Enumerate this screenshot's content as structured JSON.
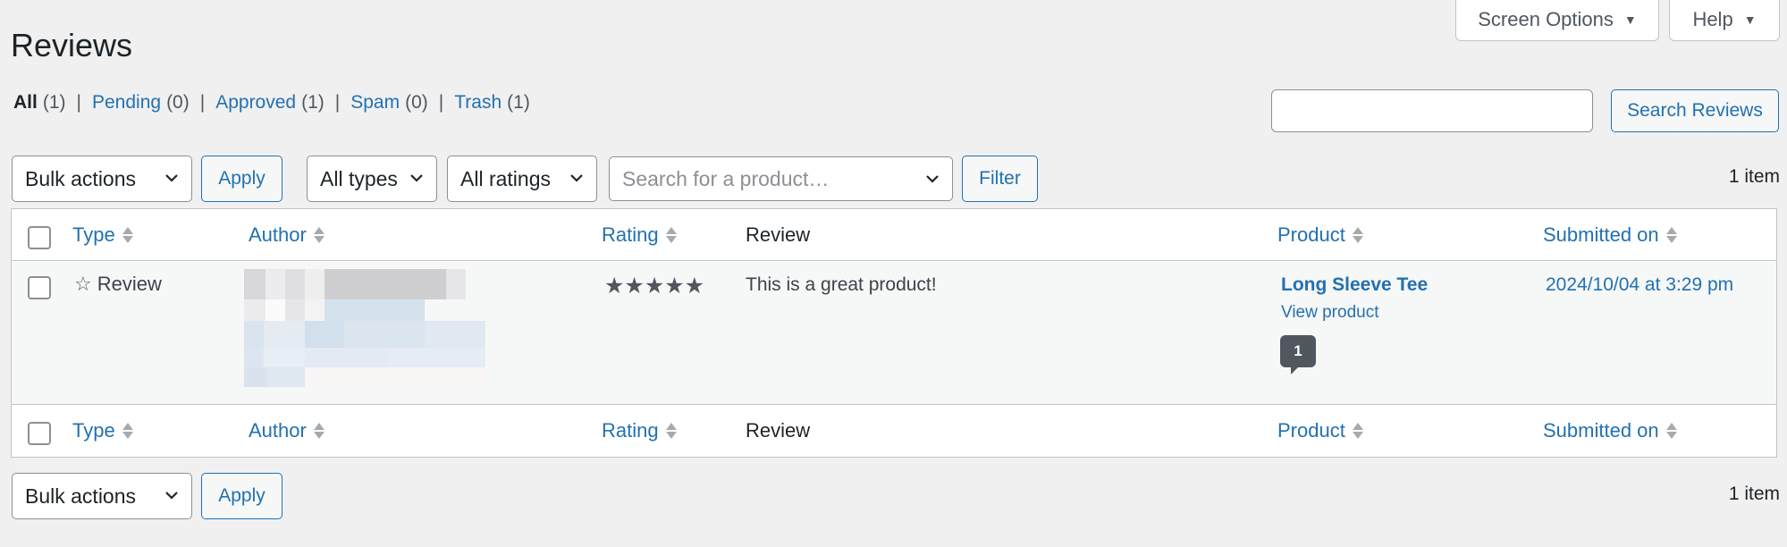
{
  "screen_options": {
    "label": "Screen Options",
    "caret": "▼"
  },
  "help": {
    "label": "Help",
    "caret": "▼"
  },
  "page_title": "Reviews",
  "filters": [
    {
      "label": "All",
      "count": "(1)",
      "current": true
    },
    {
      "label": "Pending",
      "count": "(0)",
      "current": false
    },
    {
      "label": "Approved",
      "count": "(1)",
      "current": false
    },
    {
      "label": "Spam",
      "count": "(0)",
      "current": false
    },
    {
      "label": "Trash",
      "count": "(1)",
      "current": false
    }
  ],
  "separator": "|",
  "search": {
    "value": "",
    "button": "Search Reviews"
  },
  "top_nav": {
    "bulk_actions": "Bulk actions",
    "apply": "Apply",
    "types": "All types",
    "ratings": "All ratings",
    "product_placeholder": "Search for a product…",
    "filter": "Filter",
    "count": "1 item"
  },
  "columns": {
    "type": "Type",
    "author": "Author",
    "rating": "Rating",
    "review": "Review",
    "product": "Product",
    "submitted_on": "Submitted on"
  },
  "rows": [
    {
      "type_icon": "☆",
      "type": "Review",
      "rating_stars": "★★★★★",
      "rating_value": 5,
      "review": "This is a great product!",
      "product": "Long Sleeve Tee",
      "view_product": "View product",
      "comment_count": "1",
      "submitted_on": "2024/10/04 at 3:29 pm"
    }
  ],
  "bottom_nav": {
    "bulk_actions": "Bulk actions",
    "apply": "Apply",
    "count": "1 item"
  }
}
